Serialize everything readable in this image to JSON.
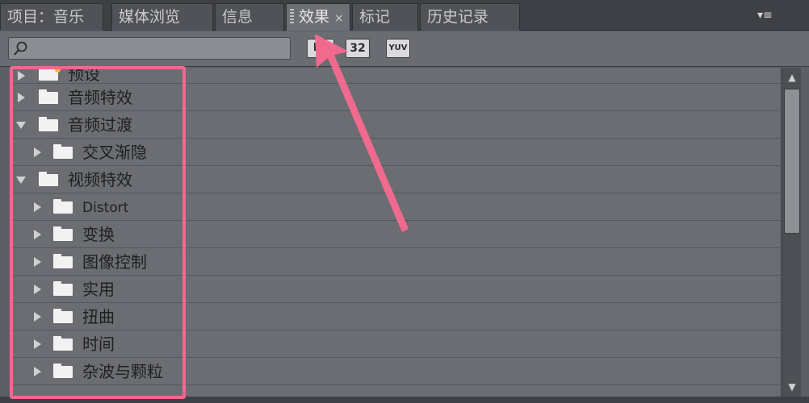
{
  "tabs": [
    {
      "label": "项目：音乐",
      "active": false
    },
    {
      "label": "媒体浏览",
      "active": false
    },
    {
      "label": "信息",
      "active": false
    },
    {
      "label": "效果",
      "active": true,
      "close": "×"
    },
    {
      "label": "标记",
      "active": false
    },
    {
      "label": "历史记录",
      "active": false
    }
  ],
  "panel_menu_icon": "▾≡",
  "search": {
    "value": "",
    "placeholder": ""
  },
  "toolbar": {
    "new_bin_icon": "new-bin-icon",
    "bit32_label": "32",
    "yuv_label": "YUV"
  },
  "tree": {
    "items": [
      {
        "label": "预设",
        "expanded": false,
        "level": 0,
        "icon": "preset-folder-icon"
      },
      {
        "label": "音频特效",
        "expanded": false,
        "level": 0,
        "icon": "folder-icon"
      },
      {
        "label": "音频过渡",
        "expanded": true,
        "level": 0,
        "icon": "folder-icon"
      },
      {
        "label": "交叉渐隐",
        "expanded": false,
        "level": 1,
        "icon": "folder-icon"
      },
      {
        "label": "视频特效",
        "expanded": true,
        "level": 0,
        "icon": "folder-icon"
      },
      {
        "label": "Distort",
        "expanded": false,
        "level": 1,
        "icon": "folder-icon"
      },
      {
        "label": "变换",
        "expanded": false,
        "level": 1,
        "icon": "folder-icon"
      },
      {
        "label": "图像控制",
        "expanded": false,
        "level": 1,
        "icon": "folder-icon"
      },
      {
        "label": "实用",
        "expanded": false,
        "level": 1,
        "icon": "folder-icon"
      },
      {
        "label": "扭曲",
        "expanded": false,
        "level": 1,
        "icon": "folder-icon"
      },
      {
        "label": "时间",
        "expanded": false,
        "level": 1,
        "icon": "folder-icon"
      },
      {
        "label": "杂波与颗粒",
        "expanded": false,
        "level": 1,
        "icon": "folder-icon"
      }
    ]
  },
  "colors": {
    "highlight": "#ee6a8e",
    "arrow": "#f06a8e",
    "panel_bg": "#6b6d73"
  }
}
